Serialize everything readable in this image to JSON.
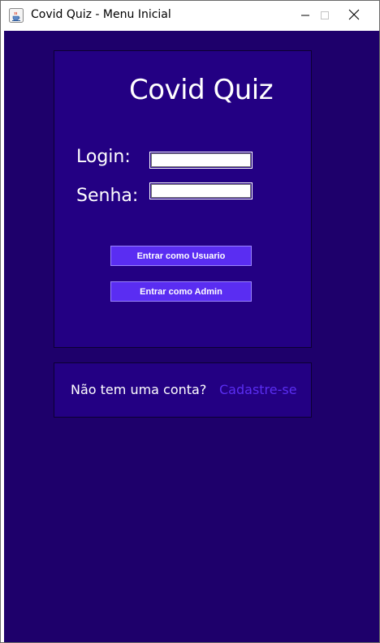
{
  "window": {
    "title": "Covid Quiz - Menu Inicial",
    "icon": "java-cup-icon"
  },
  "login_panel": {
    "title": "Covid Quiz",
    "login_label": "Login:",
    "login_value": "",
    "senha_label": "Senha:",
    "senha_value": "",
    "user_button_label": "Entrar como Usuario",
    "admin_button_label": "Entrar como Admin"
  },
  "signup_panel": {
    "question": "Não tem uma conta?",
    "link_label": "Cadastre-se"
  },
  "colors": {
    "background": "#1e006b",
    "panel": "#230083",
    "button": "#5a2df2",
    "link": "#5a2df2",
    "text": "#ffffff"
  }
}
